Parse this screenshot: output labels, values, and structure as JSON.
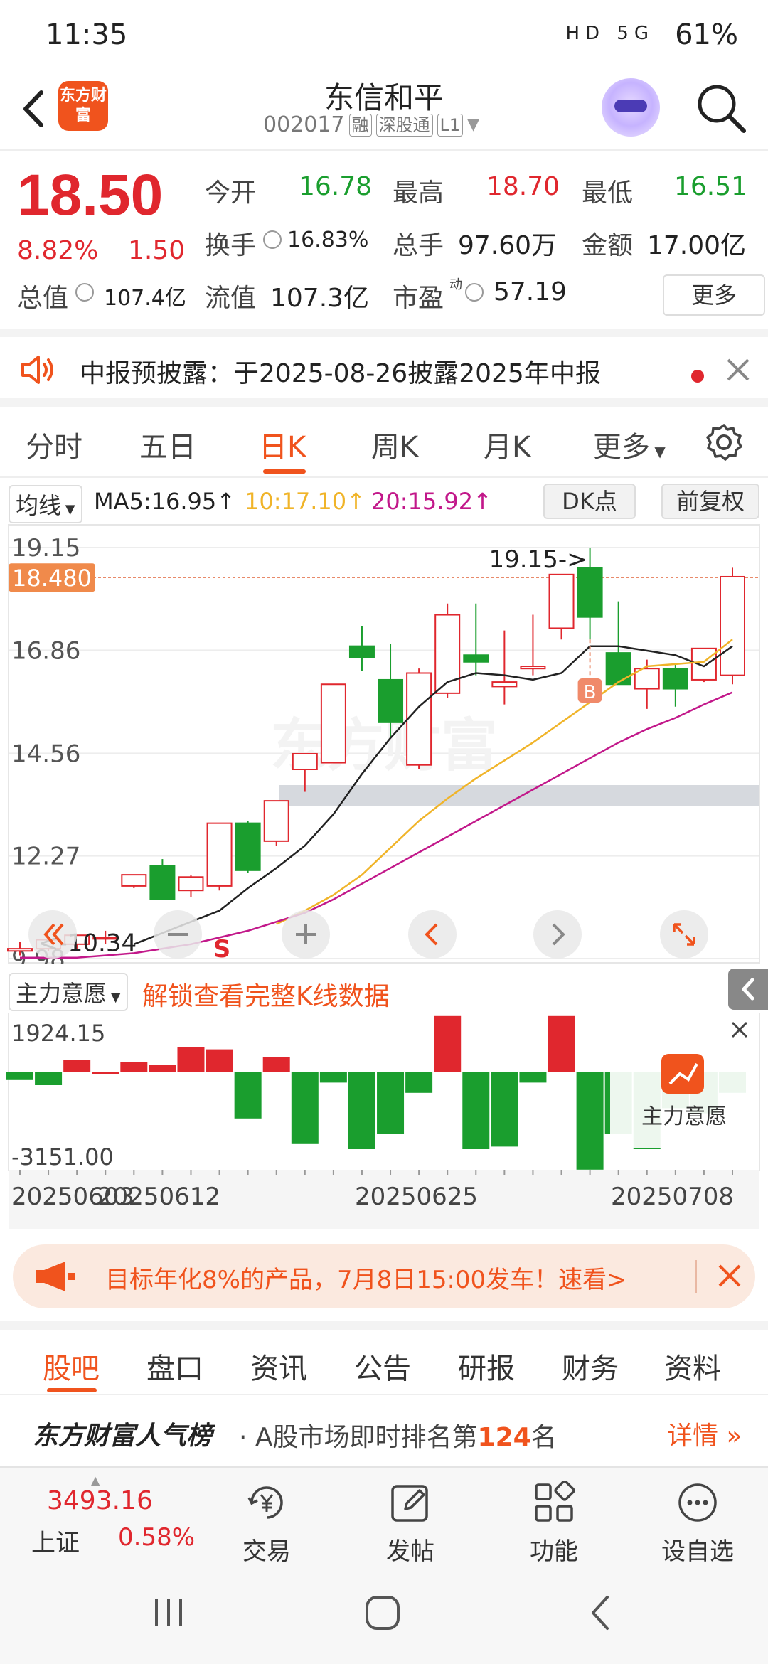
{
  "status_bar": {
    "time": "11:35",
    "battery": "61%",
    "signal_icons": "HD 5G"
  },
  "header": {
    "title": "东信和平",
    "code": "002017",
    "tags": [
      "融",
      "深股通",
      "L1"
    ],
    "logo_text": "东方财富"
  },
  "quote": {
    "price": "18.50",
    "pct": "8.82%",
    "change": "1.50",
    "open_label": "今开",
    "open": "16.78",
    "high_label": "最高",
    "high": "18.70",
    "low_label": "最低",
    "low": "16.51",
    "turnover_label": "换手",
    "turnover": "16.83%",
    "volume_label": "总手",
    "volume": "97.60万",
    "amount_label": "金额",
    "amount": "17.00亿",
    "mktcap_label": "总值",
    "mktcap": "107.4亿",
    "float_label": "流值",
    "float": "107.3亿",
    "pe_label": "市盈",
    "pe_sup": "动",
    "pe": "57.19",
    "more": "更多"
  },
  "notice": {
    "text": "中报预披露：于2025-08-26披露2025年中报"
  },
  "tabs": [
    "分时",
    "五日",
    "日K",
    "周K",
    "月K",
    "更多"
  ],
  "ma": {
    "select": "均线",
    "ma5": "MA5:16.95↑",
    "ma10": "10:17.10↑",
    "ma20": "20:15.92↑",
    "dk": "DK点",
    "fq": "前复权"
  },
  "colors": {
    "up": "#e0272e",
    "down": "#1a9e2e",
    "ma5": "#222222",
    "ma10": "#f0b429",
    "ma20": "#c2188a",
    "accent": "#f0531d"
  },
  "chart_data": {
    "type": "candlestick",
    "ylim": [
      9.98,
      19.15
    ],
    "y_ticks": [
      "19.15",
      "16.86",
      "14.56",
      "12.27",
      "9.98"
    ],
    "current_label": "18.480",
    "max_label": "19.15->",
    "min_label": "<-10.34",
    "marker_b": "B",
    "marker_s": "S",
    "x_labels": [
      "20250603",
      "20250612",
      "20250625",
      "20250708"
    ],
    "candles": [
      {
        "o": 10.15,
        "h": 10.35,
        "l": 10.05,
        "c": 10.2
      },
      {
        "o": 10.2,
        "h": 10.45,
        "l": 10.15,
        "c": 10.4
      },
      {
        "o": 10.3,
        "h": 10.5,
        "l": 10.2,
        "c": 10.5
      },
      {
        "o": 10.45,
        "h": 10.6,
        "l": 10.3,
        "c": 10.45
      },
      {
        "o": 11.6,
        "h": 11.85,
        "l": 11.55,
        "c": 11.85
      },
      {
        "o": 12.05,
        "h": 12.2,
        "l": 11.3,
        "c": 11.3
      },
      {
        "o": 11.5,
        "h": 11.85,
        "l": 11.35,
        "c": 11.8
      },
      {
        "o": 11.6,
        "h": 13.0,
        "l": 11.5,
        "c": 13.0
      },
      {
        "o": 13.0,
        "h": 13.05,
        "l": 11.9,
        "c": 11.95
      },
      {
        "o": 12.6,
        "h": 13.5,
        "l": 12.5,
        "c": 13.5
      },
      {
        "o": 14.2,
        "h": 14.55,
        "l": 13.7,
        "c": 14.55
      },
      {
        "o": 14.35,
        "h": 16.1,
        "l": 14.35,
        "c": 16.1
      },
      {
        "o": 16.95,
        "h": 17.4,
        "l": 16.4,
        "c": 16.7
      },
      {
        "o": 16.2,
        "h": 17.0,
        "l": 14.9,
        "c": 15.25
      },
      {
        "o": 14.3,
        "h": 16.45,
        "l": 14.2,
        "c": 16.35
      },
      {
        "o": 15.9,
        "h": 17.9,
        "l": 15.8,
        "c": 17.65
      },
      {
        "o": 16.75,
        "h": 17.9,
        "l": 16.3,
        "c": 16.6
      },
      {
        "o": 16.05,
        "h": 17.3,
        "l": 15.65,
        "c": 16.15
      },
      {
        "o": 16.45,
        "h": 17.65,
        "l": 16.3,
        "c": 16.5
      },
      {
        "o": 17.35,
        "h": 18.55,
        "l": 17.1,
        "c": 18.55
      },
      {
        "o": 18.7,
        "h": 19.15,
        "l": 17.1,
        "c": 17.6
      },
      {
        "o": 16.8,
        "h": 17.95,
        "l": 16.1,
        "c": 16.1
      },
      {
        "o": 16.0,
        "h": 16.65,
        "l": 15.55,
        "c": 16.45
      },
      {
        "o": 16.45,
        "h": 16.55,
        "l": 15.6,
        "c": 16.0
      },
      {
        "o": 16.2,
        "h": 16.9,
        "l": 16.15,
        "c": 16.9
      },
      {
        "o": 16.3,
        "h": 18.7,
        "l": 16.1,
        "c": 18.5
      }
    ],
    "series": [
      {
        "name": "MA5",
        "values": [
          null,
          null,
          null,
          null,
          10.3,
          10.55,
          10.8,
          11.05,
          11.55,
          12.0,
          12.5,
          13.2,
          14.1,
          14.9,
          15.6,
          16.15,
          16.35,
          16.3,
          16.2,
          16.35,
          16.95,
          16.95,
          16.85,
          16.75,
          16.5,
          16.95
        ]
      },
      {
        "name": "MA10",
        "values": [
          null,
          null,
          null,
          null,
          null,
          null,
          null,
          null,
          null,
          10.75,
          11.05,
          11.4,
          11.85,
          12.45,
          13.05,
          13.55,
          14.0,
          14.4,
          14.8,
          15.25,
          15.7,
          16.15,
          16.5,
          16.55,
          16.6,
          17.1
        ]
      },
      {
        "name": "MA20",
        "values": [
          10.0,
          10.0,
          10.0,
          10.05,
          10.1,
          10.2,
          10.3,
          10.45,
          10.6,
          10.8,
          11.0,
          11.3,
          11.65,
          12.0,
          12.35,
          12.7,
          13.05,
          13.4,
          13.75,
          14.1,
          14.45,
          14.8,
          15.1,
          15.35,
          15.65,
          15.92
        ]
      }
    ]
  },
  "indicator": {
    "select": "主力意愿",
    "unlock": "解锁查看完整K线数据",
    "max_label": "1924.15",
    "min_label": "-3151.00",
    "overlay_label": "主力意愿",
    "bars": [
      -3,
      -5,
      5,
      0,
      4,
      3,
      10,
      9,
      -18,
      6,
      -28,
      -4,
      -30,
      -24,
      -8,
      22,
      -30,
      -29,
      -4,
      22,
      -38,
      -24,
      -30,
      -14,
      -16,
      -8
    ]
  },
  "promo": {
    "text": "目标年化8%的产品，7月8日15:00发车！速看>"
  },
  "bottom_tabs": [
    "股吧",
    "盘口",
    "资讯",
    "公告",
    "研报",
    "财务",
    "资料"
  ],
  "rank": {
    "title": "东方财富人气榜",
    "desc_prefix": "· A股市场即时排名第",
    "num": "124",
    "desc_suffix": "名",
    "detail": "详情"
  },
  "dock": {
    "index_val": "3493.16",
    "index_name": "上证",
    "index_pct": "0.58%",
    "items": [
      "交易",
      "发帖",
      "功能",
      "设自选"
    ]
  }
}
